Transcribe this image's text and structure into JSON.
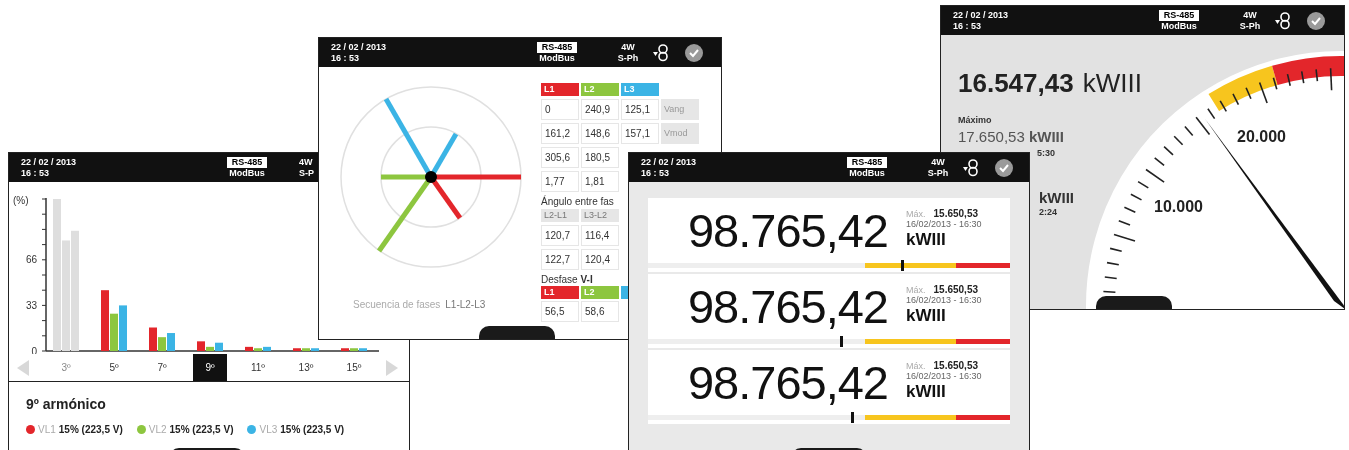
{
  "harmonics_screen": {
    "header": {
      "date": "22 / 02 / 2013",
      "time": "16 : 53",
      "port": "RS-485",
      "protocol": "ModBus",
      "wiring": "4W",
      "phase": "S-P"
    },
    "chart_data": {
      "type": "bar",
      "ylabel": "(%)",
      "categories": [
        "3º",
        "5º",
        "7º",
        "9º",
        "11º",
        "13º",
        "15º"
      ],
      "yticks": [
        0,
        33,
        66
      ],
      "ylim": [
        0,
        110
      ],
      "series": [
        {
          "name": "VL1",
          "color": "#e3262b",
          "values": [
            null,
            44,
            17,
            7,
            3,
            2,
            2
          ]
        },
        {
          "name": "VL2",
          "color": "#8dc63f",
          "values": [
            null,
            27,
            10,
            3,
            2,
            2,
            2
          ]
        },
        {
          "name": "VL3",
          "color": "#3bb4e5",
          "values": [
            null,
            33,
            13,
            6,
            3,
            2,
            2
          ]
        },
        {
          "color": "#dedede",
          "values": [
            110,
            null,
            null,
            null,
            null,
            null,
            null
          ]
        },
        {
          "color": "#dedede",
          "values": [
            80,
            null,
            null,
            null,
            null,
            null,
            null
          ]
        },
        {
          "color": "#dedede",
          "values": [
            87,
            null,
            null,
            null,
            null,
            null,
            null
          ]
        }
      ]
    },
    "tabs": [
      {
        "selected": false,
        "greyed": true
      },
      {
        "selected": false,
        "greyed": false
      },
      {
        "selected": false,
        "greyed": false
      },
      {
        "selected": true,
        "greyed": false
      },
      {
        "selected": false,
        "greyed": false
      },
      {
        "selected": false,
        "greyed": false
      },
      {
        "selected": false,
        "greyed": false
      }
    ],
    "detail_title": "9º armónico",
    "legend_values": [
      "15% (223,5 V)",
      "15% (223,5 V)",
      "15% (223,5 V)"
    ]
  },
  "phasor_screen": {
    "header": {
      "date": "22 / 02 / 2013",
      "time": "16 : 53",
      "port": "RS-485",
      "protocol": "ModBus",
      "wiring": "4W",
      "phase": "S-Ph",
      "status_icons": true
    },
    "sequence_label": "Secuencia de fases",
    "sequence_value": "L1-L2-L3",
    "phase_table": {
      "headers": [
        {
          "label": "L1",
          "color": "#e3262b"
        },
        {
          "label": "L2",
          "color": "#8dc63f"
        },
        {
          "label": "L3",
          "color": "#3bb4e5"
        }
      ],
      "rows": [
        {
          "cells": [
            "0",
            "240,9",
            "125,1"
          ],
          "unit": "Vang"
        },
        {
          "cells": [
            "161,2",
            "148,6",
            "157,1"
          ],
          "unit": "Vmod"
        },
        {
          "cells": [
            "305,6",
            "180,5"
          ]
        },
        {
          "cells": [
            "1,77",
            "1,81"
          ]
        }
      ]
    },
    "angle_title": "Ángulo entre fas",
    "angle_table": {
      "headers": [
        "L2-L1",
        "L3-L2"
      ],
      "rows": [
        [
          "120,7",
          "116,4"
        ],
        [
          "122,7",
          "120,4"
        ]
      ]
    },
    "shift_title": "Desfase **V-I**",
    "shift_table": {
      "headers": [
        {
          "label": "L1",
          "color": "#e3262b"
        },
        {
          "label": "L2",
          "color": "#8dc63f"
        },
        {
          "color": "#3bb4e5"
        }
      ],
      "rows": [
        [
          "56,5",
          "58,6"
        ]
      ]
    }
  },
  "gauge_screen": {
    "header": {
      "date": "22 / 02 / 2013",
      "time": "16 : 53",
      "port": "RS-485",
      "protocol": "ModBus",
      "wiring": "4W",
      "phase": "S-Ph",
      "status_icons": true
    },
    "value": "16.547,43",
    "unit": "kWIII",
    "max_title": "Máximo",
    "max_value": "17.650,53 **kWIII**",
    "max_time_fragment": "5:30",
    "min_unit_fragment": "kWIII",
    "min_time_fragment": "2:24",
    "scale_labels": [
      "20.000",
      "10.000"
    ]
  },
  "energy_screen": {
    "header": {
      "date": "22 / 02 / 2013",
      "time": "16 : 53",
      "port": "RS-485",
      "protocol": "ModBus",
      "wiring": "4W",
      "phase": "S-Ph",
      "status_icons": true
    },
    "readings": [
      {
        "value": "98.765,42",
        "max_label": "Máx.",
        "max_value": "15.650,53",
        "max_time": "16/02/2013 - 16:30",
        "unit": "kWIII",
        "level": 0.7
      },
      {
        "value": "98.765,42",
        "max_label": "Máx.",
        "max_value": "15.650,53",
        "max_time": "16/02/2013 - 16:30",
        "unit": "kWIII",
        "level": 0.53
      },
      {
        "value": "98.765,42",
        "max_label": "Máx.",
        "max_value": "15.650,53",
        "max_time": "16/02/2013 - 16:30",
        "unit": "kWIII",
        "level": 0.56
      }
    ]
  }
}
